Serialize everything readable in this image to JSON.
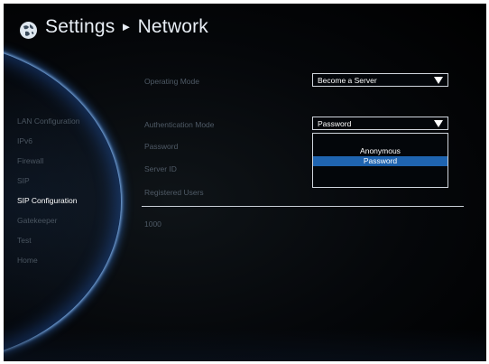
{
  "header": {
    "title": "Settings",
    "separator": "►",
    "section": "Network"
  },
  "sidebar": {
    "items": [
      {
        "label": "LAN Configuration",
        "active": false
      },
      {
        "label": "IPv6",
        "active": false
      },
      {
        "label": "Firewall",
        "active": false
      },
      {
        "label": "SIP",
        "active": false
      },
      {
        "label": "SIP Configuration",
        "active": true
      },
      {
        "label": "Gatekeeper",
        "active": false
      },
      {
        "label": "Test",
        "active": false
      },
      {
        "label": "Home",
        "active": false
      }
    ]
  },
  "form": {
    "operating_mode": {
      "label": "Operating Mode",
      "value": "Become a Server"
    },
    "authentication_mode": {
      "label": "Authentication Mode",
      "value": "Password",
      "options": [
        "Anonymous",
        "Password"
      ],
      "selected": "Password"
    },
    "password": {
      "label": "Password"
    },
    "server_id": {
      "label": "Server ID"
    },
    "registered_users": {
      "label": "Registered Users",
      "rows": [
        "1000"
      ]
    }
  },
  "colors": {
    "accent_selected": "#1f64b0",
    "text_active": "#ffffff",
    "text_inactive": "#4a5560",
    "arc_glow": "#3c82e6"
  }
}
